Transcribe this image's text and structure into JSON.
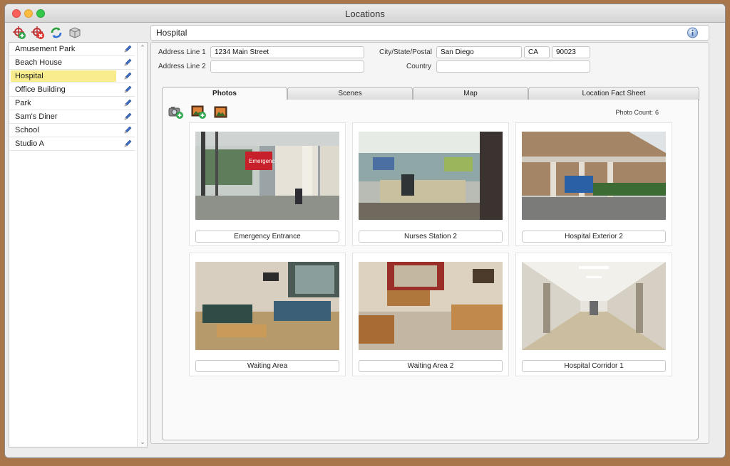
{
  "window": {
    "title": "Locations"
  },
  "toolbar": {
    "icons": [
      "add-location-icon",
      "remove-location-icon",
      "refresh-icon",
      "box-icon"
    ]
  },
  "locations": {
    "items": [
      {
        "label": "Amusement Park"
      },
      {
        "label": "Beach House"
      },
      {
        "label": "Hospital",
        "selected": true
      },
      {
        "label": "Office Building"
      },
      {
        "label": "Park"
      },
      {
        "label": "Sam's Diner"
      },
      {
        "label": "School"
      },
      {
        "label": "Studio A"
      }
    ]
  },
  "detail": {
    "name": "Hospital",
    "address_line1_label": "Address Line 1",
    "address_line1": "1234 Main Street",
    "address_line2_label": "Address Line 2",
    "address_line2": "",
    "city_state_postal_label": "City/State/Postal",
    "city": "San Diego",
    "state": "CA",
    "postal": "90023",
    "country_label": "Country",
    "country": ""
  },
  "tabs": [
    {
      "label": "Photos",
      "active": true
    },
    {
      "label": "Scenes"
    },
    {
      "label": "Map"
    },
    {
      "label": "Location Fact Sheet"
    }
  ],
  "photos": {
    "count_label": "Photo Count:",
    "count": "6",
    "items": [
      {
        "caption": "Emergency Entrance"
      },
      {
        "caption": "Nurses Station 2"
      },
      {
        "caption": "Hospital Exterior 2"
      },
      {
        "caption": "Waiting Area"
      },
      {
        "caption": "Waiting Area 2"
      },
      {
        "caption": "Hospital Corridor 1"
      }
    ]
  },
  "colors": {
    "selected_row": "#f8ec8c",
    "frame": "#a8764a"
  }
}
